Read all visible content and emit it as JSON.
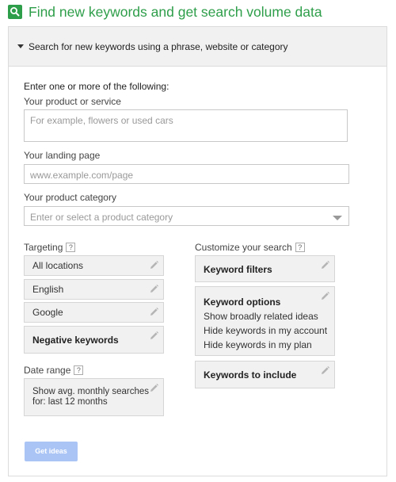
{
  "header": {
    "title": "Find new keywords and get search volume data",
    "icon": "search-icon"
  },
  "panel": {
    "title": "Search for new keywords using a phrase, website or category",
    "intro": "Enter one or more of the following:",
    "product": {
      "label": "Your product or service",
      "placeholder": "For example, flowers or used cars"
    },
    "landing": {
      "label": "Your landing page",
      "placeholder": "www.example.com/page"
    },
    "category": {
      "label": "Your product category",
      "placeholder": "Enter or select a product category"
    },
    "targeting": {
      "label": "Targeting",
      "help": "?",
      "items": [
        "All locations",
        "English",
        "Google",
        "Negative keywords"
      ]
    },
    "date_range": {
      "label": "Date range",
      "help": "?",
      "line1": "Show avg. monthly searches",
      "line2": "for: last 12 months"
    },
    "customize": {
      "label": "Customize your search",
      "help": "?",
      "filters": "Keyword filters",
      "options_title": "Keyword options",
      "options": [
        "Show broadly related ideas",
        "Hide keywords in my account",
        "Hide keywords in my plan"
      ],
      "include": "Keywords to include"
    },
    "button": "Get ideas"
  },
  "colors": {
    "brand": "#2e9e4a",
    "button": "#a9c4f5"
  }
}
